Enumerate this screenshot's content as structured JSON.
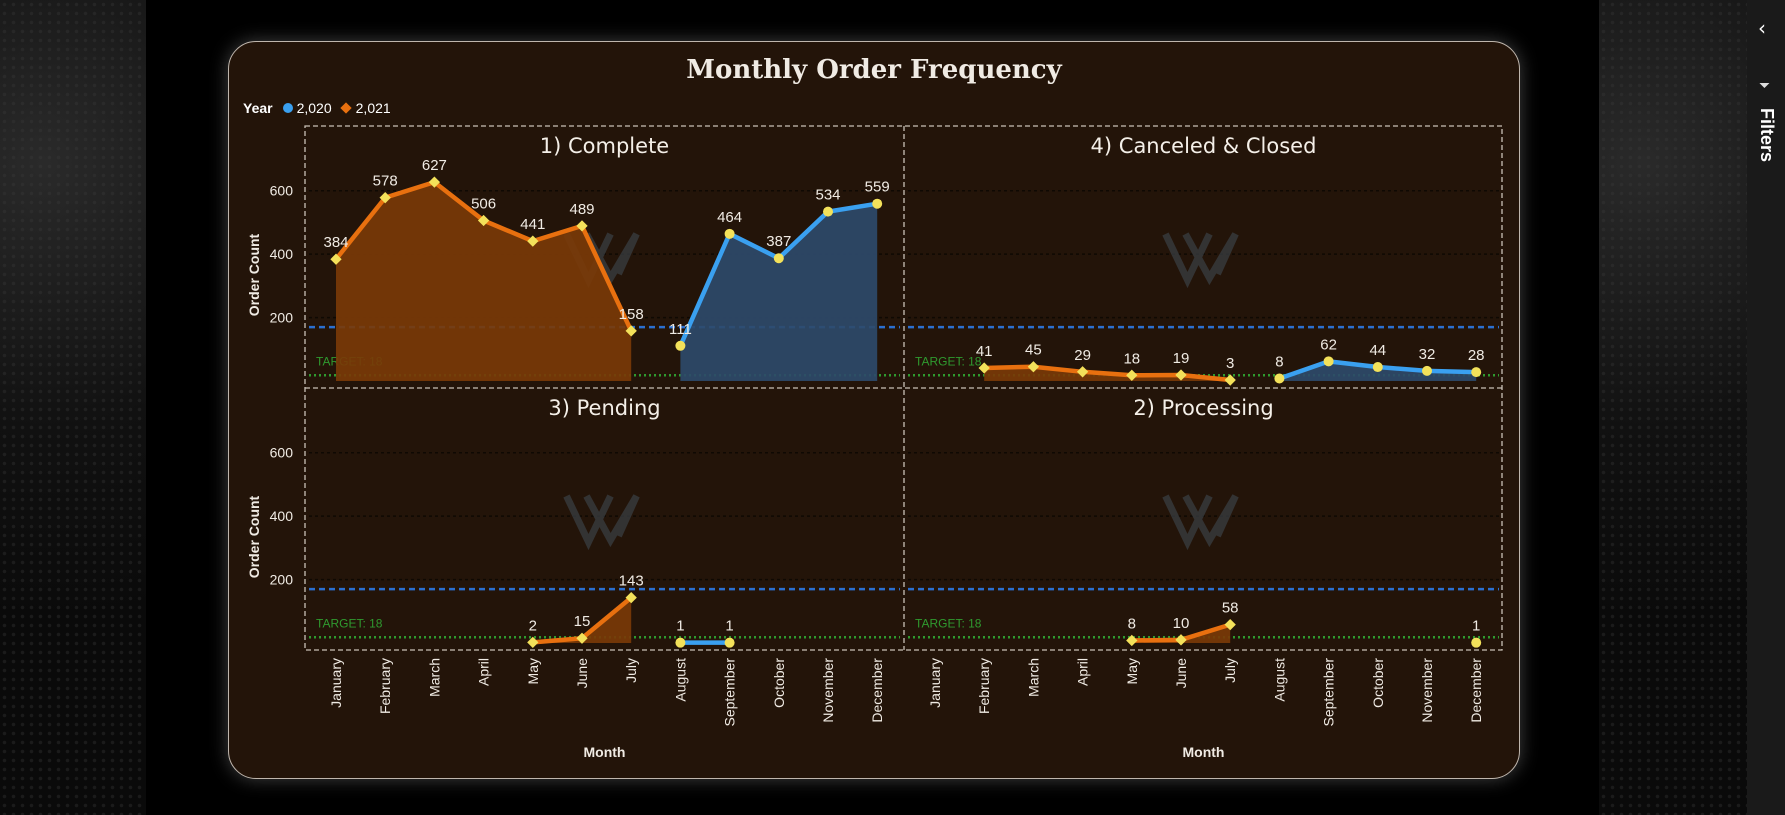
{
  "page": {
    "title": "Monthly Order Frequency",
    "filters_label": "Filters"
  },
  "legend": {
    "label": "Year",
    "items": [
      {
        "name": "2,020",
        "color": "#3aa0f0",
        "marker": "circle"
      },
      {
        "name": "2,021",
        "color": "#e8700f",
        "marker": "diamond"
      }
    ]
  },
  "colors": {
    "card_bg": "#231409",
    "series_2020": "#3aa0f0",
    "series_2021": "#e8700f",
    "area_2020": "#2e4a6a",
    "area_2021": "#7a3a08",
    "marker": "#f3e15a",
    "target": "#2f9a2f",
    "avg_line": "#2b6fd0"
  },
  "chart_data": {
    "type": "line",
    "title": "Monthly Order Frequency",
    "xlabel": "Month",
    "ylabel": "Order Count",
    "ylim": [
      0,
      700
    ],
    "yticks": [
      200,
      400,
      600
    ],
    "target_label": "TARGET: 18",
    "target_value": 18,
    "categories": [
      "January",
      "February",
      "March",
      "April",
      "May",
      "June",
      "July",
      "August",
      "September",
      "October",
      "November",
      "December"
    ],
    "panels": [
      {
        "title": "1) Complete",
        "series": [
          {
            "name": "2,021",
            "values": [
              384,
              578,
              627,
              506,
              441,
              489,
              158,
              null,
              null,
              null,
              null,
              null
            ]
          },
          {
            "name": "2,020",
            "values": [
              null,
              null,
              null,
              null,
              null,
              null,
              null,
              111,
              464,
              387,
              534,
              559
            ]
          }
        ]
      },
      {
        "title": "4) Canceled & Closed",
        "series": [
          {
            "name": "2,021",
            "values": [
              null,
              41,
              45,
              29,
              18,
              19,
              3,
              null,
              null,
              null,
              null,
              null
            ]
          },
          {
            "name": "2,020",
            "values": [
              null,
              null,
              null,
              null,
              null,
              null,
              null,
              8,
              62,
              44,
              32,
              28
            ]
          }
        ]
      },
      {
        "title": "3) Pending",
        "series": [
          {
            "name": "2,021",
            "values": [
              null,
              null,
              null,
              null,
              2,
              15,
              143,
              null,
              null,
              null,
              null,
              null
            ]
          },
          {
            "name": "2,020",
            "values": [
              null,
              null,
              null,
              null,
              null,
              null,
              null,
              1,
              1,
              null,
              null,
              null
            ]
          }
        ]
      },
      {
        "title": "2) Processing",
        "series": [
          {
            "name": "2,021",
            "values": [
              null,
              null,
              null,
              null,
              8,
              10,
              58,
              null,
              null,
              null,
              null,
              null
            ]
          },
          {
            "name": "2,020",
            "values": [
              null,
              null,
              null,
              null,
              null,
              null,
              null,
              null,
              null,
              null,
              null,
              1
            ]
          }
        ]
      }
    ]
  }
}
